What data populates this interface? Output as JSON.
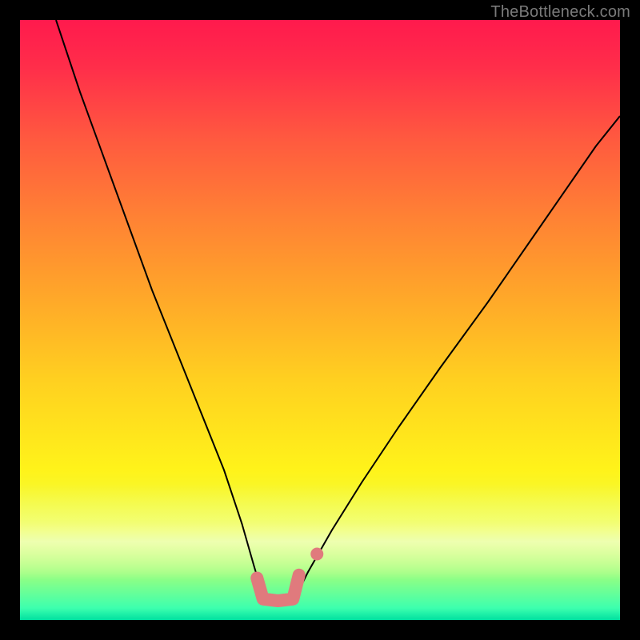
{
  "watermark": "TheBottleneck.com",
  "chart_data": {
    "type": "line",
    "title": "",
    "xlabel": "",
    "ylabel": "",
    "xlim": [
      0,
      100
    ],
    "ylim": [
      0,
      100
    ],
    "grid": false,
    "legend": false,
    "series": [
      {
        "name": "bottleneck-curve",
        "color": "#000000",
        "stroke_width": 2,
        "x": [
          6,
          10,
          14,
          18,
          22,
          26,
          30,
          34,
          37,
          39,
          40.5,
          44.5,
          46,
          48,
          52,
          57,
          63,
          70,
          78,
          87,
          96,
          100
        ],
        "y": [
          100,
          88,
          77,
          66,
          55,
          45,
          35,
          25,
          16,
          9,
          4,
          3.5,
          4,
          8,
          15,
          23,
          32,
          42,
          53,
          66,
          79,
          84
        ]
      },
      {
        "name": "bottom-marker",
        "color": "#e07a7d",
        "stroke_width": 16,
        "linecap": "round",
        "x": [
          39.5,
          40.5,
          43,
          45.5,
          46.5
        ],
        "y": [
          7,
          3.5,
          3.2,
          3.5,
          7.5
        ]
      },
      {
        "name": "bottom-marker-dot",
        "type": "scatter",
        "color": "#e07a7d",
        "radius": 8,
        "x": [
          49.5
        ],
        "y": [
          11
        ]
      }
    ]
  }
}
